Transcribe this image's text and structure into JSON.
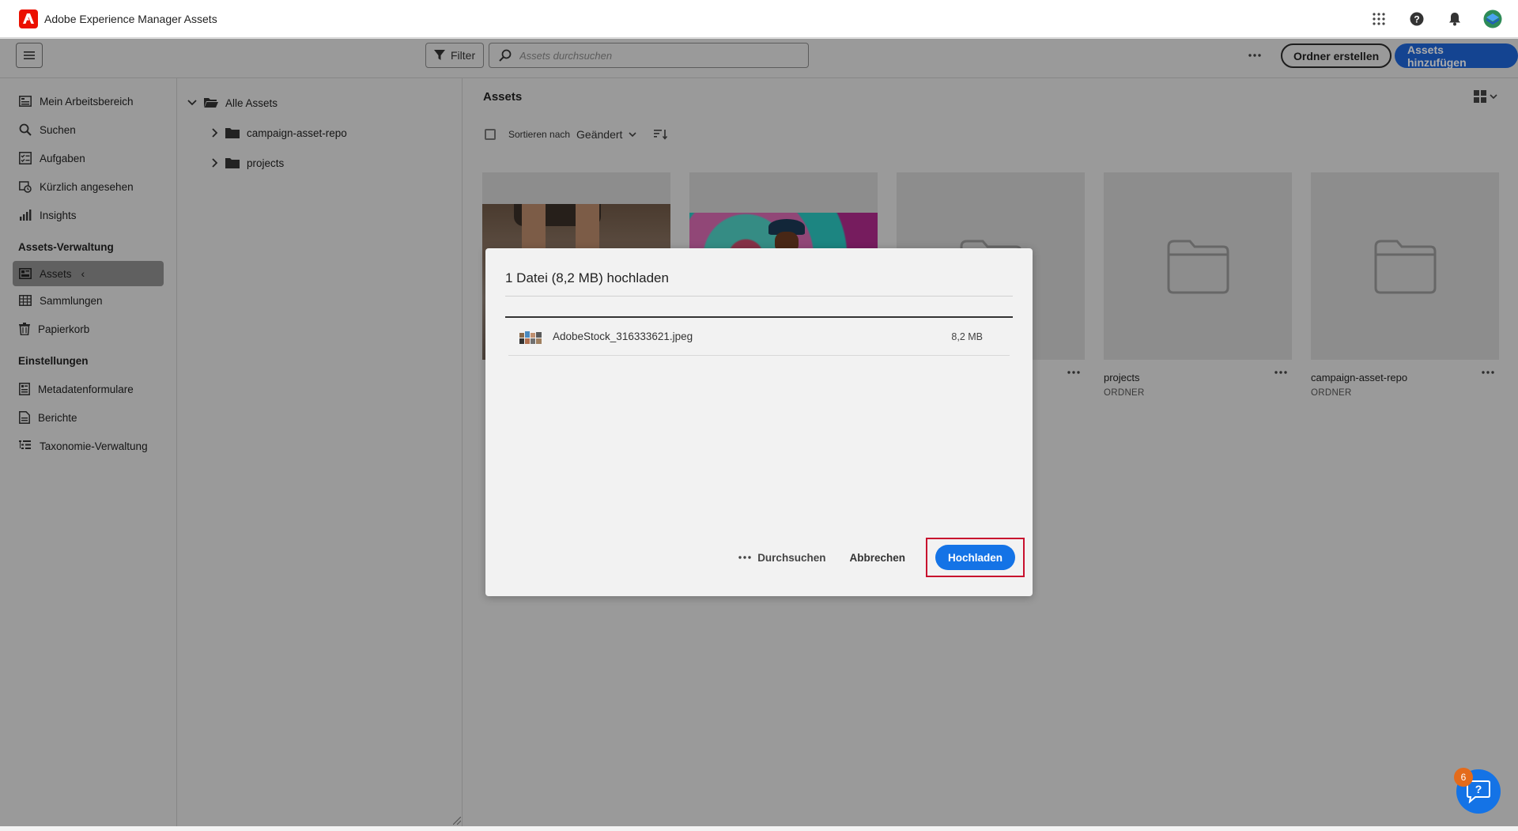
{
  "app": {
    "title": "Adobe Experience Manager Assets"
  },
  "toolbar": {
    "filter_label": "Filter",
    "search_placeholder": "Assets durchsuchen",
    "create_folder_label": "Ordner erstellen",
    "add_assets_label": "Assets hinzufügen"
  },
  "sidebar": {
    "items_top": [
      {
        "label": "Mein Arbeitsbereich",
        "icon": "workspace-icon"
      },
      {
        "label": "Suchen",
        "icon": "search-icon"
      },
      {
        "label": "Aufgaben",
        "icon": "tasks-icon"
      },
      {
        "label": "Kürzlich angesehen",
        "icon": "recent-icon"
      },
      {
        "label": "Insights",
        "icon": "insights-icon"
      }
    ],
    "section_assets": "Assets-Verwaltung",
    "items_assets": [
      {
        "label": "Assets",
        "icon": "assets-icon",
        "active": true
      },
      {
        "label": "Sammlungen",
        "icon": "collections-icon"
      },
      {
        "label": "Papierkorb",
        "icon": "trash-icon"
      }
    ],
    "section_settings": "Einstellungen",
    "items_settings": [
      {
        "label": "Metadatenformulare",
        "icon": "metadata-forms-icon"
      },
      {
        "label": "Berichte",
        "icon": "reports-icon"
      },
      {
        "label": "Taxonomie-Verwaltung",
        "icon": "taxonomy-icon"
      }
    ]
  },
  "tree": {
    "root": "Alle Assets",
    "children": [
      "campaign-asset-repo",
      "projects"
    ]
  },
  "main": {
    "title": "Assets",
    "sort_label": "Sortieren nach",
    "sort_value": "Geändert",
    "cards": [
      {
        "name": "",
        "type": "",
        "kind": "image-runner"
      },
      {
        "name": "",
        "type": "",
        "kind": "image-art"
      },
      {
        "name": "",
        "type": "",
        "kind": "folder"
      },
      {
        "name": "projects",
        "type": "ORDNER",
        "kind": "folder"
      },
      {
        "name": "campaign-asset-repo",
        "type": "ORDNER",
        "kind": "folder"
      }
    ]
  },
  "dialog": {
    "title": "1 Datei (8,2 MB) hochladen",
    "file": {
      "name": "AdobeStock_316333621.jpeg",
      "size": "8,2 MB"
    },
    "browse_label": "Durchsuchen",
    "cancel_label": "Abbrechen",
    "upload_label": "Hochladen"
  },
  "help": {
    "badge_count": "6"
  },
  "colors": {
    "accent": "#1473e6",
    "brand": "#eb1000",
    "highlight": "#c8102e"
  }
}
